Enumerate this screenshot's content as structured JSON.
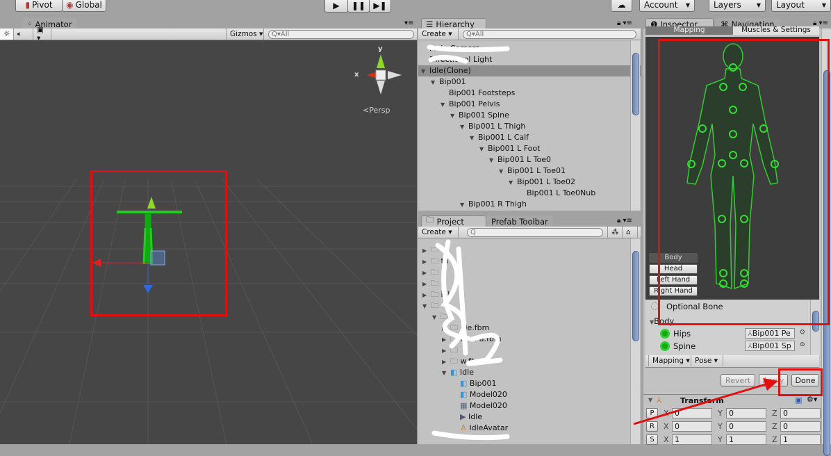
{
  "toolbar": {
    "pivot": "Pivot",
    "global": "Global",
    "account": "Account",
    "layers": "Layers",
    "layout": "Layout",
    "play_icon": "play-icon",
    "pause_icon": "pause-icon",
    "step_icon": "step-icon",
    "cloud_icon": "cloud-icon"
  },
  "scene": {
    "tab": "Animator",
    "gizmos": "Gizmos",
    "search_placeholder": "All",
    "persp": "Persp",
    "axis_x": "x",
    "axis_y": "y"
  },
  "hierarchy": {
    "tab": "Hierarchy",
    "create": "Create",
    "search_placeholder": "All",
    "items": [
      {
        "label": "Main Camera",
        "depth": 0
      },
      {
        "label": "Directional Light",
        "depth": 0
      },
      {
        "label": "Idle(Clone)",
        "depth": 0,
        "expanded": true,
        "selected": true
      },
      {
        "label": "Bip001",
        "depth": 1,
        "expanded": true
      },
      {
        "label": "Bip001 Footsteps",
        "depth": 2
      },
      {
        "label": "Bip001 Pelvis",
        "depth": 2,
        "expanded": true
      },
      {
        "label": "Bip001 Spine",
        "depth": 3,
        "expanded": true
      },
      {
        "label": "Bip001 L Thigh",
        "depth": 4,
        "expanded": true
      },
      {
        "label": "Bip001 L Calf",
        "depth": 5,
        "expanded": true
      },
      {
        "label": "Bip001 L Foot",
        "depth": 6,
        "expanded": true
      },
      {
        "label": "Bip001 L Toe0",
        "depth": 7,
        "expanded": true
      },
      {
        "label": "Bip001 L Toe01",
        "depth": 8,
        "expanded": true
      },
      {
        "label": "Bip001 L Toe02",
        "depth": 9,
        "expanded": true
      },
      {
        "label": "Bip001 L Toe0Nub",
        "depth": 10
      },
      {
        "label": "Bip001 R Thigh",
        "depth": 4,
        "expanded": true
      }
    ]
  },
  "project": {
    "tab": "Project",
    "tab2": "Prefab Toolbar",
    "create": "Create",
    "items": [
      {
        "label": "",
        "depth": 0,
        "icon": "folder",
        "arrow": "right"
      },
      {
        "label": "tu",
        "depth": 0,
        "icon": "folder",
        "arrow": "right"
      },
      {
        "label": "",
        "depth": 0,
        "icon": "folder",
        "arrow": "right"
      },
      {
        "label": "s",
        "depth": 0,
        "icon": "folder",
        "arrow": "right"
      },
      {
        "label": "ials",
        "depth": 0,
        "icon": "folder",
        "arrow": "right"
      },
      {
        "label": "",
        "depth": 0,
        "icon": "folder",
        "arrow": "down"
      },
      {
        "label": "",
        "depth": 1,
        "icon": "folder",
        "arrow": "down"
      },
      {
        "label": "dle.fbm",
        "depth": 2,
        "icon": "folder",
        "arrow": "right"
      },
      {
        "label": "anin a.fbm",
        "depth": 2,
        "icon": "folder",
        "arrow": "right"
      },
      {
        "label": "",
        "depth": 2,
        "icon": "folder",
        "arrow": "right"
      },
      {
        "label": "w.fbm",
        "depth": 2,
        "icon": "folder",
        "arrow": "right"
      },
      {
        "label": "Idle",
        "depth": 2,
        "icon": "model",
        "arrow": "down"
      },
      {
        "label": "Bip001",
        "depth": 3,
        "icon": "model"
      },
      {
        "label": "Model020",
        "depth": 3,
        "icon": "model"
      },
      {
        "label": "Model020",
        "depth": 3,
        "icon": "mesh"
      },
      {
        "label": "Idle",
        "depth": 3,
        "icon": "clip"
      },
      {
        "label": "IdleAvatar",
        "depth": 3,
        "icon": "avatar"
      }
    ]
  },
  "inspector": {
    "tab": "Inspector",
    "tab2": "Navigation",
    "sub_tab1": "Mapping",
    "sub_tab2": "Muscles & Settings",
    "body_buttons": [
      "Body",
      "Head",
      "Left Hand",
      "Right Hand"
    ],
    "optional_bone": "Optional Bone",
    "group": "Body",
    "bones": [
      {
        "name": "Hips",
        "value": "Bip001 Pe"
      },
      {
        "name": "Spine",
        "value": "Bip001 Sp"
      }
    ],
    "mapping": "Mapping",
    "pose": "Pose",
    "revert": "Revert",
    "apply": "Apply",
    "done": "Done",
    "transform": {
      "title": "Transform",
      "rows": [
        {
          "btn": "P",
          "x": "0",
          "y": "0",
          "z": "0"
        },
        {
          "btn": "R",
          "x": "0",
          "y": "0",
          "z": "0"
        },
        {
          "btn": "S",
          "x": "1",
          "y": "1",
          "z": "1"
        }
      ]
    }
  },
  "colors": {
    "accent_green": "#33dd33",
    "annotation_red": "#e01010",
    "selection": "#8e8e8e"
  }
}
